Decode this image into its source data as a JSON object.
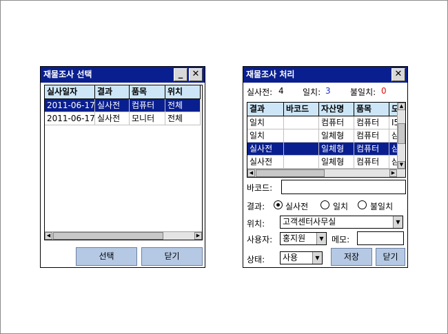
{
  "left_window": {
    "title": "재물조사 선택",
    "columns": [
      "실사일자",
      "결과",
      "품목",
      "위치"
    ],
    "rows": [
      [
        "2011-06-17",
        "실사전",
        "컴퓨터",
        "전체"
      ],
      [
        "2011-06-17",
        "실사전",
        "모니터",
        "전체"
      ]
    ],
    "select_label": "선택",
    "close_label": "닫기"
  },
  "right_window": {
    "title": "재물조사 처리",
    "pre_label": "실사전:",
    "pre_count": "4",
    "match_label": "일치:",
    "match_count": "3",
    "mismatch_label": "불일치:",
    "mismatch_count": "0",
    "columns": [
      "결과",
      "바코드",
      "자산명",
      "품목",
      "모"
    ],
    "rows": [
      [
        "일치",
        "",
        "컴퓨터",
        "컴퓨터",
        "I5"
      ],
      [
        "일치",
        "",
        "일체형",
        "컴퓨터",
        "삼"
      ],
      [
        "실사전",
        "",
        "일체형",
        "컴퓨터",
        "삼"
      ],
      [
        "실사전",
        "",
        "일체형",
        "컴퓨터",
        "삼"
      ]
    ],
    "barcode_label": "바코드:",
    "barcode_value": "",
    "result_label": "결과:",
    "result_options": [
      "실사전",
      "일치",
      "불일치"
    ],
    "result_selected": "실사전",
    "location_label": "위치:",
    "location_value": "고객센터사무실",
    "user_label": "사용자:",
    "user_value": "홍지원",
    "memo_label": "메모:",
    "memo_value": "",
    "status_label": "상태:",
    "status_value": "사용",
    "save_label": "저장",
    "close_label": "닫기"
  },
  "colors": {
    "title_bar": "#0a1f8f",
    "selection": "#0a1f8f",
    "header": "#cde6f7",
    "button": "#b5c9e4",
    "match_count": "#2030c0",
    "mismatch_count": "#e01010"
  }
}
